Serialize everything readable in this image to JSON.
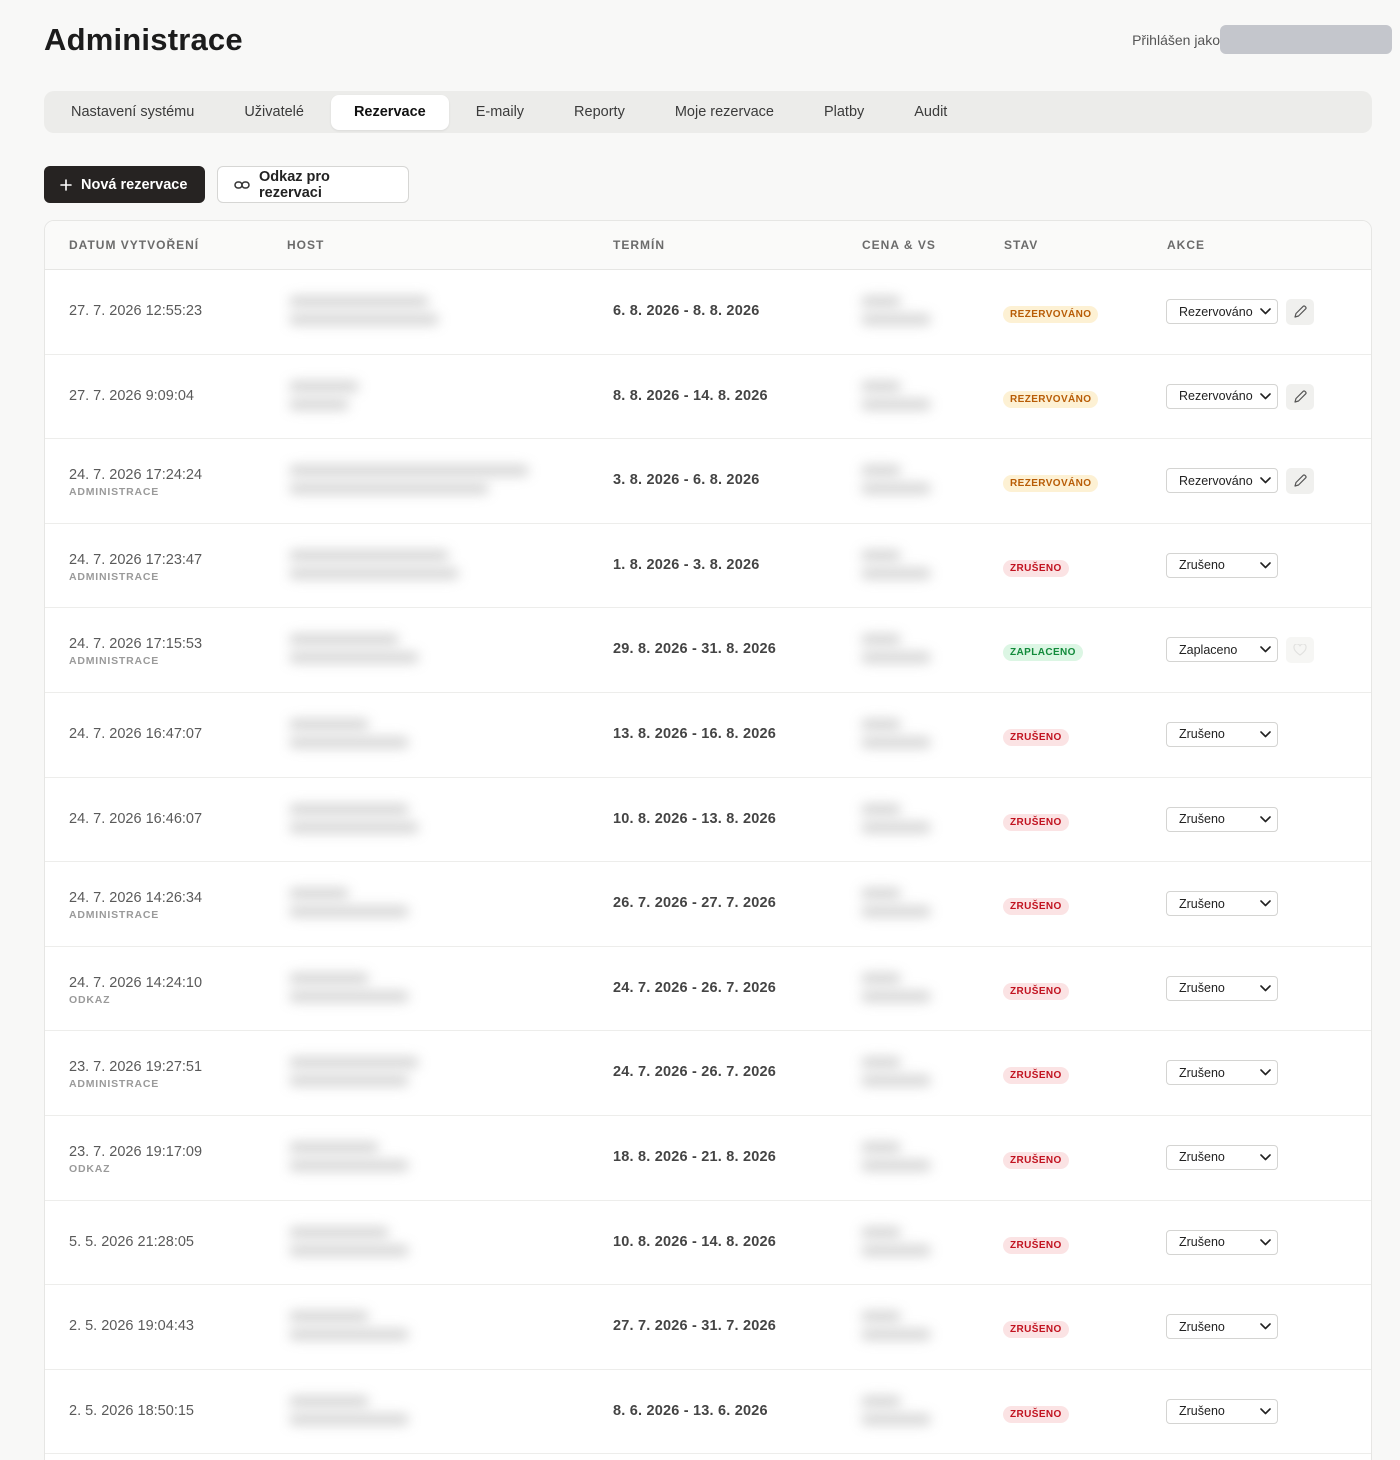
{
  "header": {
    "title": "Administrace",
    "user_label": "Přihlášen jako"
  },
  "tabs": [
    {
      "label": "Nastavení systému",
      "active": false
    },
    {
      "label": "Uživatelé",
      "active": false
    },
    {
      "label": "Rezervace",
      "active": true
    },
    {
      "label": "E-maily",
      "active": false
    },
    {
      "label": "Reporty",
      "active": false
    },
    {
      "label": "Moje rezervace",
      "active": false
    },
    {
      "label": "Platby",
      "active": false
    },
    {
      "label": "Audit",
      "active": false
    }
  ],
  "toolbar": {
    "new_label": "Nová rezervace",
    "link_label": "Odkaz pro rezervaci"
  },
  "table": {
    "columns": {
      "created": "DATUM VYTVOŘENÍ",
      "host": "HOST",
      "term": "TERMÍN",
      "price": "CENA & VS",
      "status": "STAV",
      "actions": "AKCE"
    },
    "rows": [
      {
        "created": "27. 7. 2026 12:55:23",
        "source": "",
        "term": "6. 8. 2026 - 8. 8. 2026",
        "badge": "REZERVOVÁNO",
        "badge_kind": "rez",
        "select": "Rezervováno",
        "action_icon": "pencil-icon"
      },
      {
        "created": "27. 7. 2026 9:09:04",
        "source": "",
        "term": "8. 8. 2026 - 14. 8. 2026",
        "badge": "REZERVOVÁNO",
        "badge_kind": "rez",
        "select": "Rezervováno",
        "action_icon": "pencil-icon"
      },
      {
        "created": "24. 7. 2026 17:24:24",
        "source": "ADMINISTRACE",
        "term": "3. 8. 2026 - 6. 8. 2026",
        "badge": "REZERVOVÁNO",
        "badge_kind": "rez",
        "select": "Rezervováno",
        "action_icon": "pencil-icon"
      },
      {
        "created": "24. 7. 2026 17:23:47",
        "source": "ADMINISTRACE",
        "term": "1. 8. 2026 - 3. 8. 2026",
        "badge": "ZRUŠENO",
        "badge_kind": "zru",
        "select": "Zrušeno",
        "action_icon": ""
      },
      {
        "created": "24. 7. 2026 17:15:53",
        "source": "ADMINISTRACE",
        "term": "29. 8. 2026 - 31. 8. 2026",
        "badge": "ZAPLACENO",
        "badge_kind": "zap",
        "select": "Zaplaceno",
        "action_icon": "heart-icon"
      },
      {
        "created": "24. 7. 2026 16:47:07",
        "source": "",
        "term": "13. 8. 2026 - 16. 8. 2026",
        "badge": "ZRUŠENO",
        "badge_kind": "zru",
        "select": "Zrušeno",
        "action_icon": ""
      },
      {
        "created": "24. 7. 2026 16:46:07",
        "source": "",
        "term": "10. 8. 2026 - 13. 8. 2026",
        "badge": "ZRUŠENO",
        "badge_kind": "zru",
        "select": "Zrušeno",
        "action_icon": ""
      },
      {
        "created": "24. 7. 2026 14:26:34",
        "source": "ADMINISTRACE",
        "term": "26. 7. 2026 - 27. 7. 2026",
        "badge": "ZRUŠENO",
        "badge_kind": "zru",
        "select": "Zrušeno",
        "action_icon": ""
      },
      {
        "created": "24. 7. 2026 14:24:10",
        "source": "ODKAZ",
        "term": "24. 7. 2026 - 26. 7. 2026",
        "badge": "ZRUŠENO",
        "badge_kind": "zru",
        "select": "Zrušeno",
        "action_icon": ""
      },
      {
        "created": "23. 7. 2026 19:27:51",
        "source": "ADMINISTRACE",
        "term": "24. 7. 2026 - 26. 7. 2026",
        "badge": "ZRUŠENO",
        "badge_kind": "zru",
        "select": "Zrušeno",
        "action_icon": ""
      },
      {
        "created": "23. 7. 2026 19:17:09",
        "source": "ODKAZ",
        "term": "18. 8. 2026 - 21. 8. 2026",
        "badge": "ZRUŠENO",
        "badge_kind": "zru",
        "select": "Zrušeno",
        "action_icon": ""
      },
      {
        "created": "5. 5. 2026 21:28:05",
        "source": "",
        "term": "10. 8. 2026 - 14. 8. 2026",
        "badge": "ZRUŠENO",
        "badge_kind": "zru",
        "select": "Zrušeno",
        "action_icon": ""
      },
      {
        "created": "2. 5. 2026 19:04:43",
        "source": "",
        "term": "27. 7. 2026 - 31. 7. 2026",
        "badge": "ZRUŠENO",
        "badge_kind": "zru",
        "select": "Zrušeno",
        "action_icon": ""
      },
      {
        "created": "2. 5. 2026 18:50:15",
        "source": "",
        "term": "8. 6. 2026 - 13. 6. 2026",
        "badge": "ZRUŠENO",
        "badge_kind": "zru",
        "select": "Zrušeno",
        "action_icon": ""
      }
    ]
  }
}
